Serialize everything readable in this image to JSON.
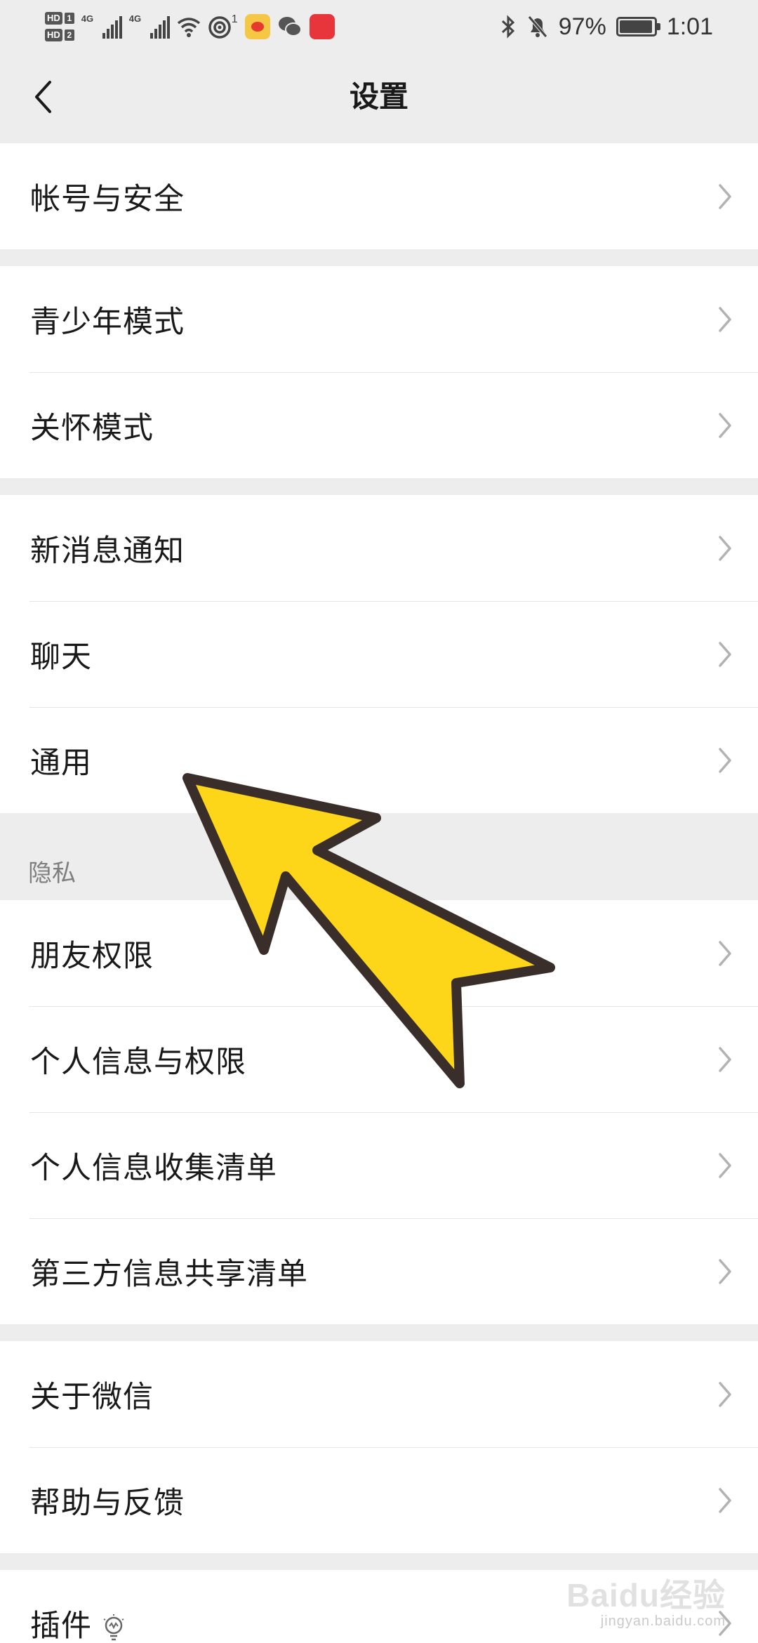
{
  "status_bar": {
    "hd1": "HD",
    "hd1_num": "1",
    "hd2": "HD",
    "hd2_num": "2",
    "net1": "4G",
    "net2": "4G",
    "hotspot_count": "1",
    "battery_percent": "97%",
    "battery_level": 0.97,
    "time": "1:01"
  },
  "header": {
    "title": "设置",
    "back_icon": "chevron-left-icon"
  },
  "groups": [
    {
      "items": [
        {
          "label": "帐号与安全"
        }
      ]
    },
    {
      "items": [
        {
          "label": "青少年模式"
        },
        {
          "label": "关怀模式"
        }
      ]
    },
    {
      "items": [
        {
          "label": "新消息通知"
        },
        {
          "label": "聊天"
        },
        {
          "label": "通用"
        }
      ]
    },
    {
      "section_title": "隐私",
      "items": [
        {
          "label": "朋友权限"
        },
        {
          "label": "个人信息与权限"
        },
        {
          "label": "个人信息收集清单"
        },
        {
          "label": "第三方信息共享清单"
        }
      ]
    },
    {
      "items": [
        {
          "label": "关于微信"
        },
        {
          "label": "帮助与反馈"
        }
      ]
    },
    {
      "items": [
        {
          "label": "插件",
          "icon": "lightbulb-icon"
        }
      ]
    }
  ],
  "watermark": {
    "text": "Baidu经验",
    "url": "jingyan.baidu.com"
  },
  "colors": {
    "background": "#ededed",
    "row": "#ffffff",
    "arrow_fill": "#fdd519",
    "arrow_stroke": "#3a2e2a"
  }
}
